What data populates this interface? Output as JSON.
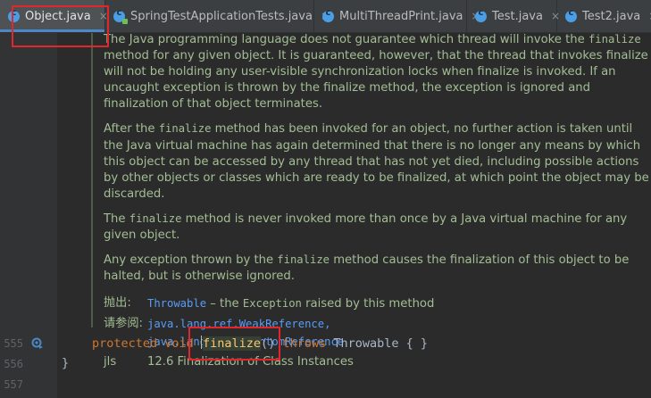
{
  "tabs": [
    {
      "label": "Object.java",
      "close": "×",
      "kind": "class"
    },
    {
      "label": "SpringTestApplicationTests.java",
      "close": "×",
      "kind": "test"
    },
    {
      "label": "MultiThreadPrint.java",
      "close": "×",
      "kind": "class"
    },
    {
      "label": "Test.java",
      "close": "×",
      "kind": "class"
    },
    {
      "label": "Test2.java",
      "close": "×",
      "kind": "class"
    }
  ],
  "doc": {
    "p1": "The Java programming language does not guarantee which thread will invoke the finalize method for any given object. It is guaranteed, however, that the thread that invokes finalize will not be holding any user-visible synchronization locks when finalize is invoked. If an uncaught exception is thrown by the finalize method, the exception is ignored and finalization of that object terminates.",
    "p1_prefix": "The Java programming language does not guarantee which thread will invoke the ",
    "p1_code": "finalize",
    "p1_suffix": " method for any given object. It is guaranteed, however, that the thread that invokes finalize will not be holding any user-visible synchronization locks when finalize is invoked. If an uncaught exception is thrown by the finalize method, the exception is ignored and finalization of that object terminates.",
    "p2_prefix": "After the ",
    "p2_code": "finalize",
    "p2_suffix": " method has been invoked for an object, no further action is taken until the Java virtual machine has again determined that there is no longer any means by which this object can be accessed by any thread that has not yet died, including possible actions by other objects or classes which are ready to be finalized, at which point the object may be discarded.",
    "p3_prefix": "The ",
    "p3_code": "finalize",
    "p3_suffix": " method is never invoked more than once by a Java virtual machine for any given object.",
    "p4_prefix": "Any exception thrown by the ",
    "p4_code": "finalize",
    "p4_suffix": " method causes the finalization of this object to be halted, but is otherwise ignored.",
    "throws_tag": "抛出:",
    "throws_link": "Throwable",
    "throws_text_a": " – the ",
    "throws_code": "Exception",
    "throws_text_b": " raised by this method",
    "see_tag": "请参阅:",
    "see_link1": "java.lang.ref.WeakReference,",
    "see_link2": "java.lang.ref.PhantomReference",
    "jls_tag": "jls",
    "jls_text": "12.6 Finalization of Class Instances"
  },
  "code": {
    "line_numbers": [
      "555",
      "556",
      "557"
    ],
    "kw_protected": "protected",
    "kw_void": "void",
    "method_name": "finalize",
    "parens": "()",
    "kw_throws": "throws",
    "type": "Throwable",
    "body": "{ }",
    "closing_brace": "}"
  },
  "icons": {
    "override": "override-method-icon",
    "file": "java-class-file-icon"
  },
  "colors": {
    "highlight_box": "#e1262c",
    "doc_text": "#a3bd94",
    "link": "#589df6",
    "keyword": "#cc7832",
    "method": "#ffc66d"
  }
}
